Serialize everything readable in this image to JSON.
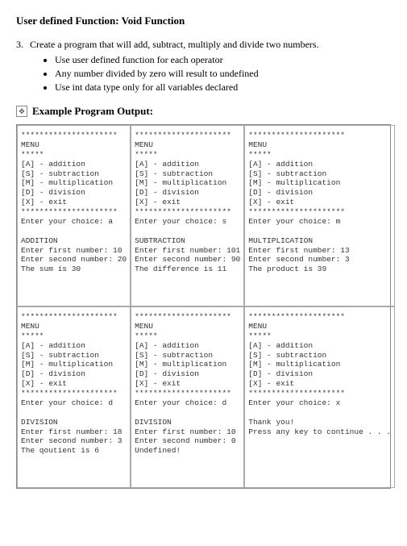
{
  "title": "User defined Function: Void Function",
  "question": {
    "number": "3.",
    "text": "Create a program that will add, subtract, multiply and divide two numbers."
  },
  "bullets": [
    "Use user defined function for each operator",
    "Any number divided by zero will result to undefined",
    "Use int data type only for all variables declared"
  ],
  "output_label": "Example Program Output:",
  "divider": "*********************",
  "short_divider": "*****",
  "dash_divider": "---------------------",
  "menu": {
    "title": "MENU",
    "items": [
      "[A] - addition",
      "[S] - subtraction",
      "[M] - multiplication",
      "[D] - division",
      "[X] - exit"
    ]
  },
  "panels": [
    {
      "choice_line": "Enter your choice: a",
      "op_title": "ADDITION",
      "lines": [
        "Enter first number: 10",
        "Enter second number: 20",
        "The sum is 30"
      ]
    },
    {
      "choice_line": "Enter your choice: s",
      "op_title": "SUBTRACTION",
      "lines": [
        "Enter first number: 101",
        "Enter second number: 90",
        "The difference is 11"
      ]
    },
    {
      "choice_line": "Enter your choice: m",
      "op_title": "MULTIPLICATION",
      "lines": [
        "Enter first number: 13",
        "Enter second number: 3",
        "The product is 39"
      ]
    },
    {
      "choice_line": "Enter your choice: d",
      "op_title": "DIVISION",
      "lines": [
        "Enter first number: 18",
        "Enter second number: 3",
        "The qoutient is 6"
      ]
    },
    {
      "choice_line": "Enter your choice: d",
      "op_title": "DIVISION",
      "lines": [
        "Enter first number: 10",
        "Enter second number: 0",
        "Undefined!"
      ]
    },
    {
      "choice_line": "Enter your choice: x",
      "op_title": "",
      "lines": [
        "Thank you!",
        "Press any key to continue . . ."
      ]
    }
  ]
}
